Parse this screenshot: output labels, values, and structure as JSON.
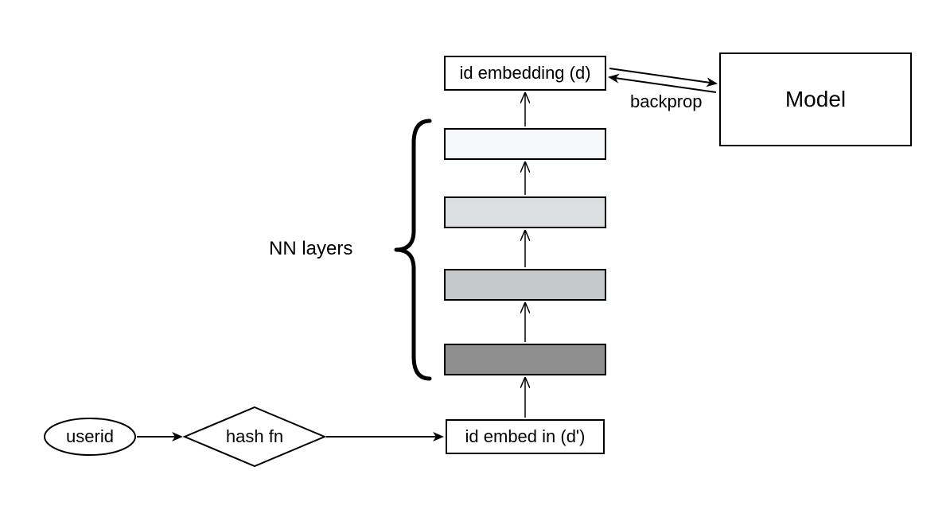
{
  "nodes": {
    "userid": "userid",
    "hashfn": "hash fn",
    "embed_in": "id embed in (d')",
    "embed_out": "id embedding (d)",
    "model": "Model"
  },
  "labels": {
    "nn_layers": "NN layers",
    "backprop": "backprop"
  },
  "layers": {
    "fills": [
      "#8f8f8f",
      "#c5c9cb",
      "#dcdfe0",
      "#f6f8f9"
    ]
  }
}
